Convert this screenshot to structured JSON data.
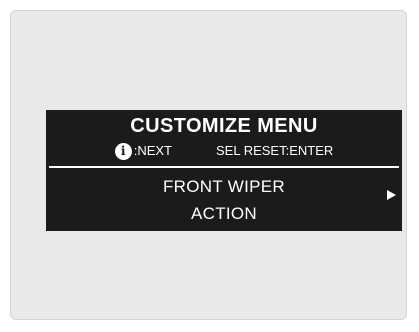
{
  "display": {
    "title": "CUSTOMIZE MENU",
    "hint_next_icon": "info-icon",
    "hint_next_text": ":NEXT",
    "hint_reset_text": "SEL RESET:ENTER",
    "item_line1": "FRONT WIPER",
    "item_line2": "ACTION",
    "item_arrow_icon": "right-triangle-icon"
  },
  "colors": {
    "screen_background": "#1b1b1b",
    "screen_text": "#ffffff",
    "frame_background": "#e9e9e9"
  }
}
